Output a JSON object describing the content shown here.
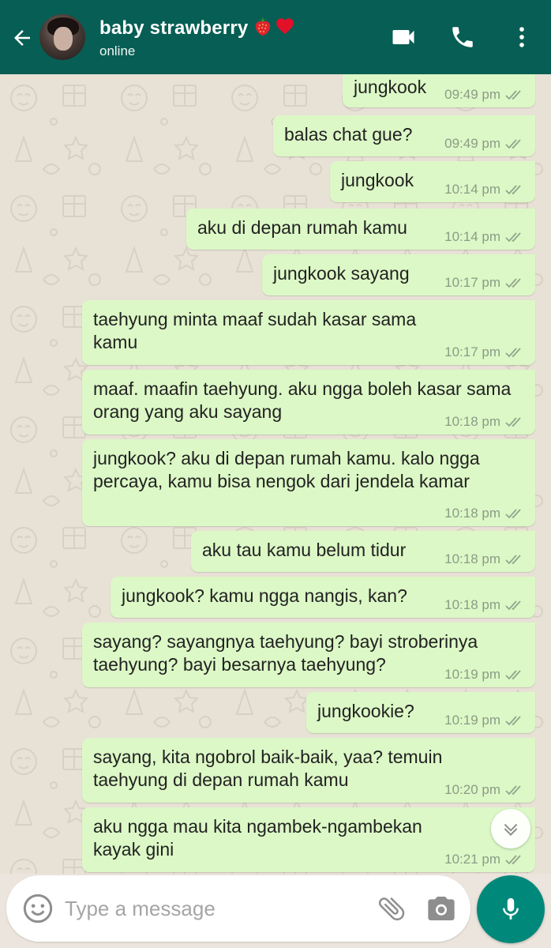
{
  "header": {
    "contact_name": "baby strawberry",
    "name_emojis": [
      "strawberry",
      "red-heart"
    ],
    "status": "online",
    "color": "#075e54",
    "icons": [
      "back-arrow-icon",
      "video-call-icon",
      "voice-call-icon",
      "more-options-icon"
    ]
  },
  "messages": [
    {
      "text": "jungkook",
      "time": "09:49 pm",
      "status": "delivered"
    },
    {
      "text": "balas chat gue?",
      "time": "09:49 pm",
      "status": "delivered"
    },
    {
      "text": "jungkook",
      "time": "10:14 pm",
      "status": "delivered"
    },
    {
      "text": "aku di depan rumah kamu",
      "time": "10:14 pm",
      "status": "delivered"
    },
    {
      "text": "jungkook sayang",
      "time": "10:17 pm",
      "status": "delivered"
    },
    {
      "text": "taehyung minta maaf sudah kasar sama kamu",
      "time": "10:17 pm",
      "status": "delivered"
    },
    {
      "text": "maaf. maafin taehyung. aku ngga boleh kasar sama orang yang aku sayang",
      "time": "10:18 pm",
      "status": "delivered"
    },
    {
      "text": "jungkook? aku di depan rumah kamu. kalo ngga percaya, kamu bisa nengok dari jendela kamar",
      "time": "10:18 pm",
      "status": "delivered"
    },
    {
      "text": "aku tau kamu belum tidur",
      "time": "10:18 pm",
      "status": "delivered"
    },
    {
      "text": "jungkook? kamu ngga nangis, kan?",
      "time": "10:18 pm",
      "status": "delivered"
    },
    {
      "text": "sayang? sayangnya taehyung? bayi stroberinya taehyung? bayi besarnya taehyung?",
      "time": "10:19 pm",
      "status": "delivered"
    },
    {
      "text": "jungkookie?",
      "time": "10:19 pm",
      "status": "delivered"
    },
    {
      "text": "sayang, kita ngobrol baik-baik, yaa? temuin taehyung di depan rumah kamu",
      "time": "10:20 pm",
      "status": "delivered"
    },
    {
      "text": "aku ngga mau kita ngambek-ngambekan kayak gini",
      "time": "10:21 pm",
      "status": "delivered"
    }
  ],
  "bubble_color": "#dcf8c6",
  "input": {
    "placeholder": "Type a message",
    "value": ""
  },
  "mic_color": "#00897b"
}
